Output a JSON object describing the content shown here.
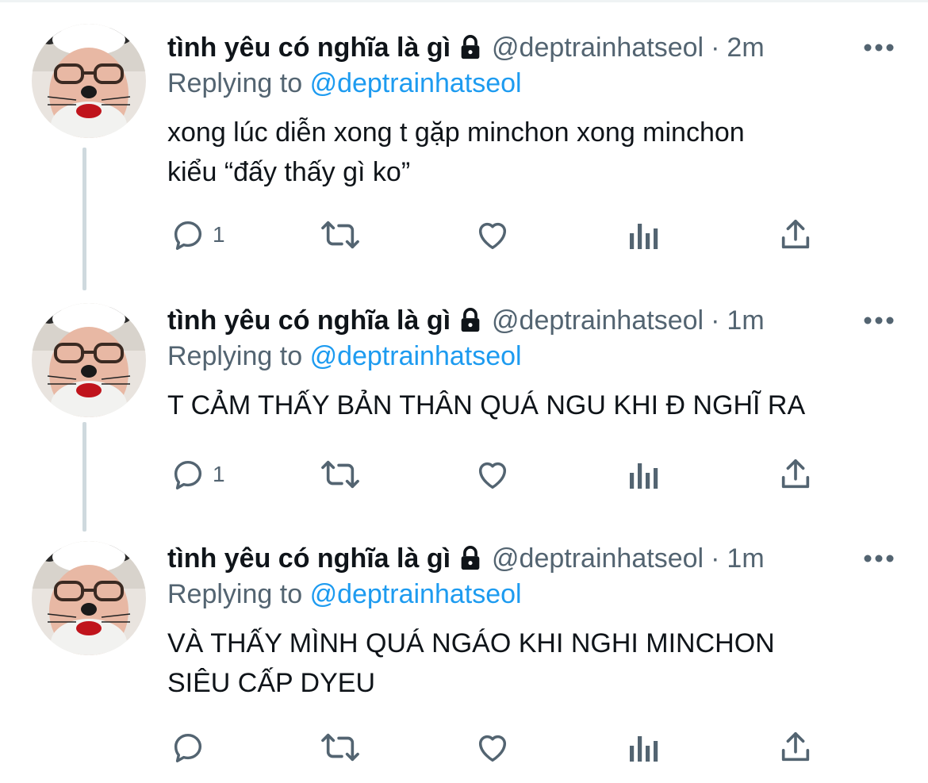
{
  "tweets": [
    {
      "display_name": "tình yêu có nghĩa là gì",
      "handle": "@deptrainhatseol",
      "separator": "·",
      "time": "2m",
      "replying_prefix": "Replying to",
      "replying_handle": "@deptrainhatseol",
      "lines": [
        "xong lúc diễn xong t gặp minchon xong minchon",
        "kiểu “đấy thấy gì ko”"
      ],
      "reply_count": "1"
    },
    {
      "display_name": "tình yêu có nghĩa là gì",
      "handle": "@deptrainhatseol",
      "separator": "·",
      "time": "1m",
      "replying_prefix": "Replying to",
      "replying_handle": "@deptrainhatseol",
      "lines": [
        "T CẢM THẤY BẢN THÂN QUÁ NGU KHI Đ NGHĨ RA"
      ],
      "reply_count": "1"
    },
    {
      "display_name": "tình yêu có nghĩa là gì",
      "handle": "@deptrainhatseol",
      "separator": "·",
      "time": "1m",
      "replying_prefix": "Replying to",
      "replying_handle": "@deptrainhatseol",
      "lines": [
        "VÀ THẤY MÌNH QUÁ NGÁO KHI NGHI MINCHON",
        "SIÊU CẤP DYEU"
      ],
      "reply_count": ""
    }
  ],
  "icons": {
    "lock": "lock-icon",
    "more": "more-icon",
    "reply": "reply-icon",
    "retweet": "retweet-icon",
    "like": "like-icon",
    "views": "views-icon",
    "share": "share-icon"
  },
  "colors": {
    "text": "#0f1419",
    "secondary": "#536471",
    "link": "#1d9bf0",
    "thread_line": "#cfd9de"
  }
}
